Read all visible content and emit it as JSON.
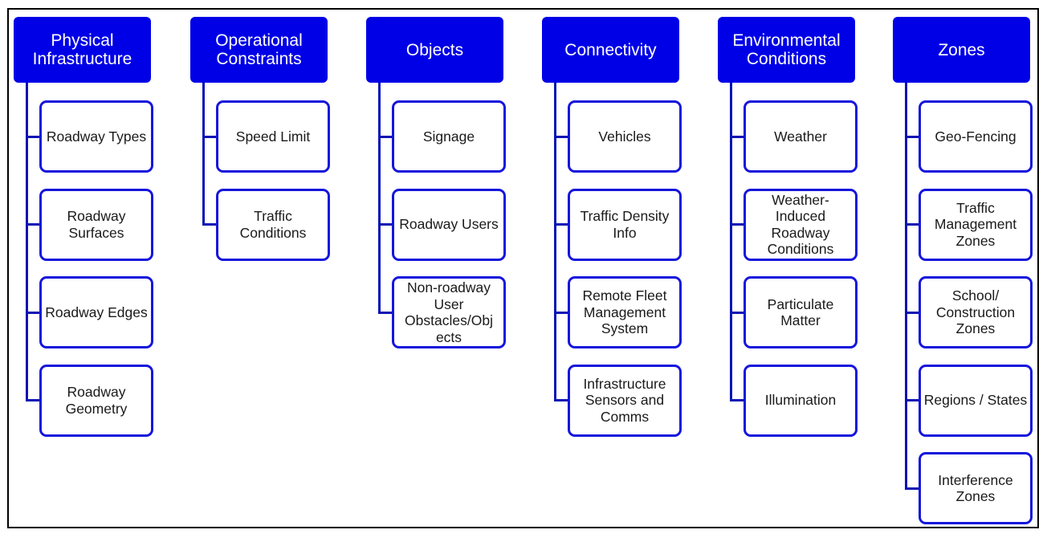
{
  "diagram": {
    "colors": {
      "header_fill": "#0000e6",
      "child_border": "#1515dc",
      "connector": "#0a14b4",
      "frame": "#000000"
    },
    "columns": [
      {
        "header": "Physical Infrastructure",
        "children": [
          "Roadway Types",
          "Roadway Surfaces",
          "Roadway Edges",
          "Roadway Geometry"
        ]
      },
      {
        "header": "Operational Constraints",
        "children": [
          "Speed Limit",
          "Traffic Conditions"
        ]
      },
      {
        "header": "Objects",
        "children": [
          "Signage",
          "Roadway Users",
          "Non-roadway User Obstacles/Obj ects"
        ]
      },
      {
        "header": "Connectivity",
        "children": [
          "Vehicles",
          "Traffic Density Info",
          "Remote Fleet Management System",
          "Infrastructure Sensors and Comms"
        ]
      },
      {
        "header": "Environmental Conditions",
        "children": [
          "Weather",
          "Weather-Induced Roadway Conditions",
          "Particulate Matter",
          "Illumination"
        ]
      },
      {
        "header": "Zones",
        "children": [
          "Geo-Fencing",
          "Traffic Management Zones",
          "School/ Construction Zones",
          "Regions / States",
          "Interference Zones"
        ]
      }
    ]
  }
}
